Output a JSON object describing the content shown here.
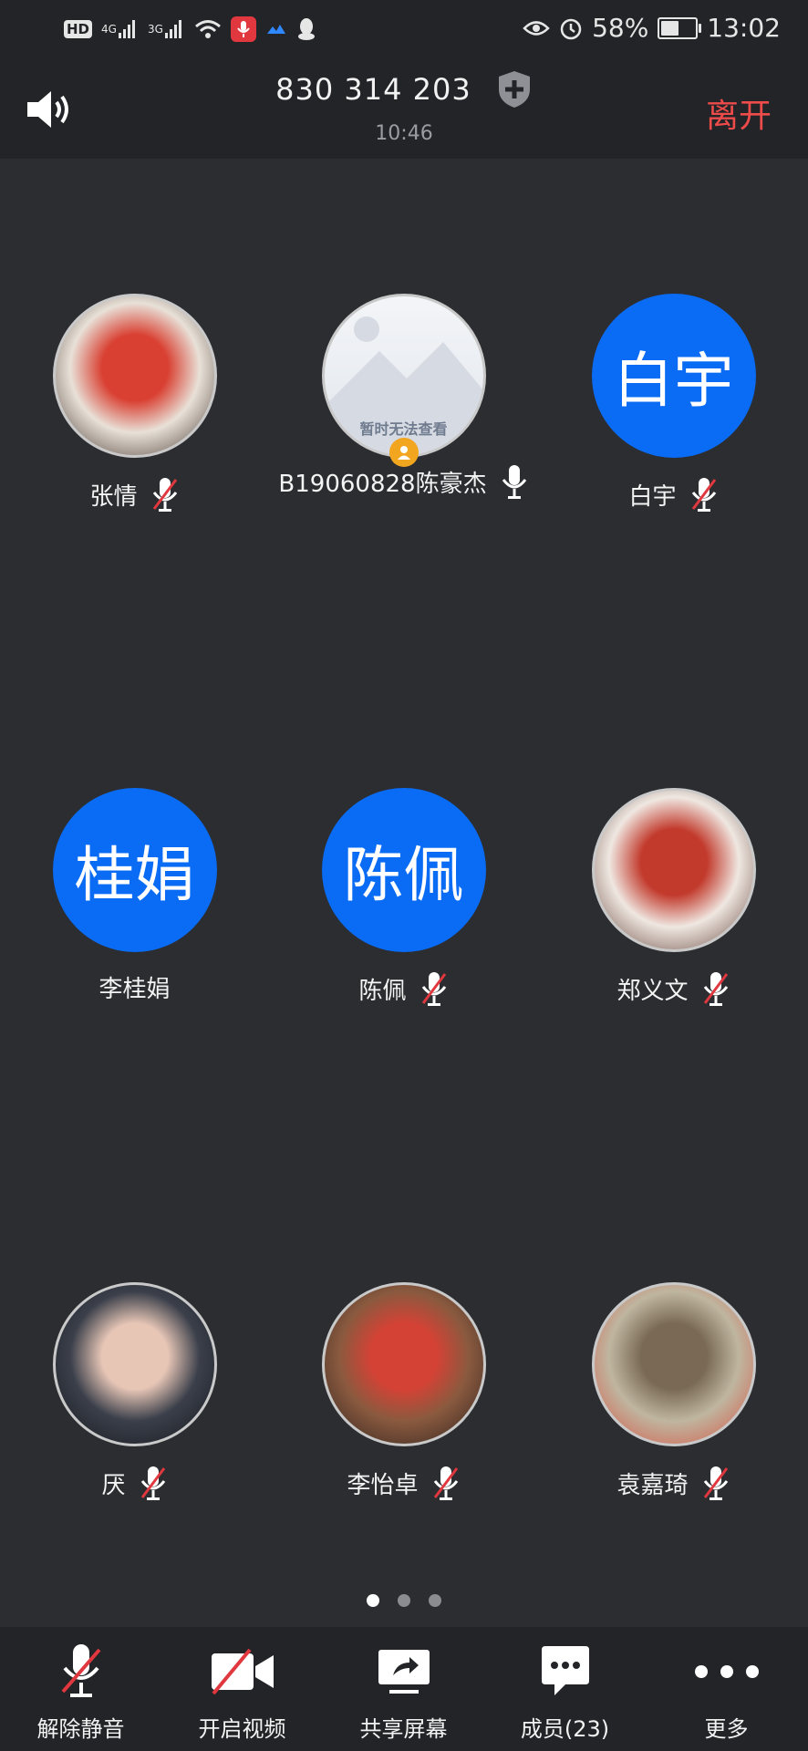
{
  "status_bar": {
    "left_icons": [
      "hd-icon",
      "4g-signal-icon",
      "3g-signal-icon",
      "wifi-icon",
      "recording-mic-icon",
      "cloud-icon",
      "qq-icon"
    ],
    "network_4g": "4G",
    "network_3g": "3G",
    "hd_label": "HD",
    "battery_percent": "58%",
    "battery_level": 0.58,
    "time": "13:02"
  },
  "header": {
    "meeting_id": "830 314 203",
    "elapsed_time": "10:46",
    "leave_label": "离开"
  },
  "participants": [
    {
      "name": "张情",
      "avatar_type": "photo",
      "avatar_colors": [
        "#e8e1d8",
        "#d94032",
        "#3b2a23"
      ],
      "mic_state": "muted"
    },
    {
      "name": "B19060828陈豪杰",
      "avatar_type": "placeholder",
      "placeholder_text": "暂时无法查看",
      "mic_state": "on"
    },
    {
      "name": "白宇",
      "avatar_type": "text",
      "avatar_text": "白宇",
      "mic_state": "muted"
    },
    {
      "name": "李桂娟",
      "avatar_type": "text",
      "avatar_text": "桂娟",
      "mic_state": "none"
    },
    {
      "name": "陈佩",
      "avatar_type": "text",
      "avatar_text": "陈佩",
      "mic_state": "muted"
    },
    {
      "name": "郑义文",
      "avatar_type": "photo",
      "avatar_colors": [
        "#efe7e1",
        "#c23a2c",
        "#5b3a2f"
      ],
      "mic_state": "muted"
    },
    {
      "name": "厌",
      "avatar_type": "photo",
      "avatar_colors": [
        "#3a3f4a",
        "#e7c6b6",
        "#15161a"
      ],
      "mic_state": "muted"
    },
    {
      "name": "李怡卓",
      "avatar_type": "photo",
      "avatar_colors": [
        "#8a5a3f",
        "#d44235",
        "#2a1f1c"
      ],
      "mic_state": "muted"
    },
    {
      "name": "袁嘉琦",
      "avatar_type": "photo",
      "avatar_colors": [
        "#bfb6a0",
        "#7a6a55",
        "#d84b3a"
      ],
      "mic_state": "muted"
    }
  ],
  "pager": {
    "pages": 3,
    "current": 1
  },
  "toolbar": {
    "unmute": "解除静音",
    "start_video": "开启视频",
    "share_screen": "共享屏幕",
    "members": "成员(23)",
    "more": "更多"
  },
  "colors": {
    "background": "#2b2d31",
    "bar": "#232427",
    "accent_blue": "#0a6cf5",
    "leave_red": "#ee4b4b",
    "mute_red": "#e0383e"
  }
}
